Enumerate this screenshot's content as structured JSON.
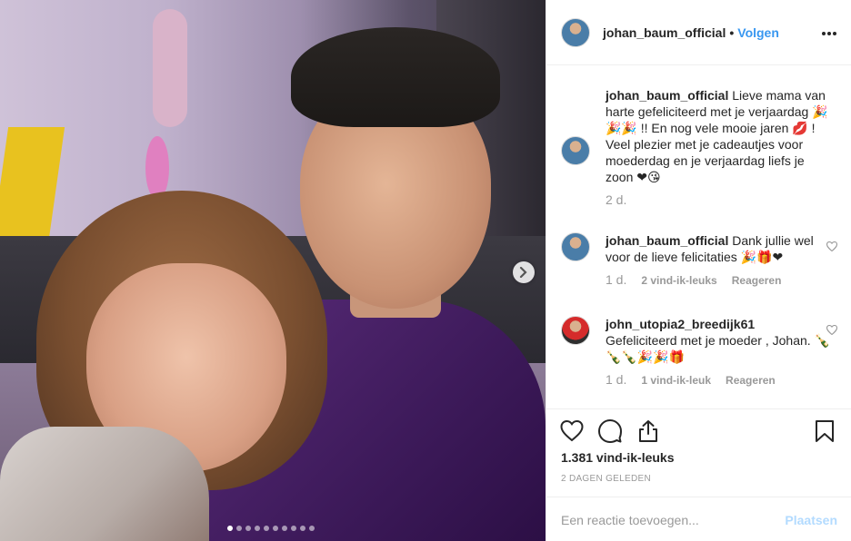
{
  "header": {
    "username": "johan_baum_official",
    "separator": "•",
    "follow_label": "Volgen",
    "more_icon": "more-horizontal-icon"
  },
  "photo": {
    "next_icon": "chevron-right-icon",
    "dot_count": 10,
    "active_dot": 1
  },
  "comments": [
    {
      "username": "johan_baum_official",
      "text": "Lieve mama van harte gefeliciteerd met je verjaardag 🎉🎉🎉 !! En nog vele mooie jaren 💋 ! Veel plezier met je cadeautjes voor moederdag en je verjaardag liefs je zoon ❤😘",
      "time": "2 d."
    },
    {
      "username": "johan_baum_official",
      "text": "Dank jullie wel voor de lieve felicitaties 🎉🎁❤",
      "time": "1 d.",
      "likes": "2 vind-ik-leuks",
      "reply": "Reageren"
    },
    {
      "username": "john_utopia2_breedijk61",
      "text": "Gefeliciteerd met je moeder , Johan. 🍾🍾🍾🎉🎉🎁",
      "time": "1 d.",
      "likes": "1 vind-ik-leuk",
      "reply": "Reageren"
    }
  ],
  "actions": {
    "like_icon": "heart-icon",
    "comment_icon": "comment-icon",
    "share_icon": "share-icon",
    "save_icon": "bookmark-icon",
    "like_count": "1.381 vind-ik-leuks",
    "post_date": "2 DAGEN GELEDEN"
  },
  "comment_box": {
    "placeholder": "Een reactie toevoegen...",
    "post_label": "Plaatsen"
  },
  "colors": {
    "accent": "#3897f0",
    "post_disabled": "#b3dbff",
    "muted": "#999999"
  }
}
